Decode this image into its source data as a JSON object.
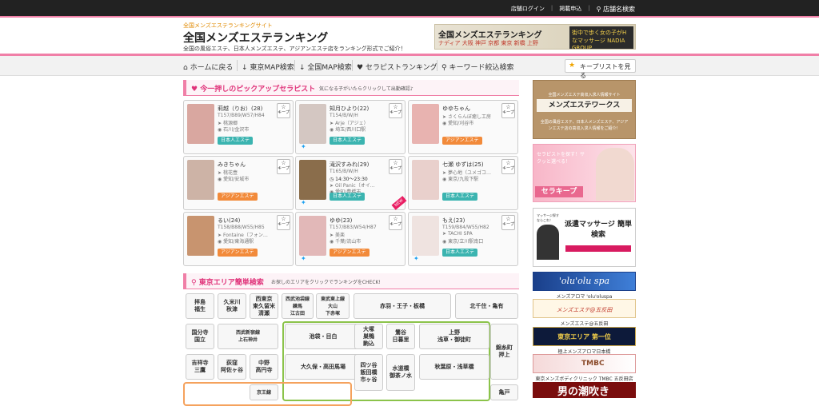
{
  "topbar": {
    "login": "店舗ログイン",
    "listing": "掲載申込",
    "search": "店舗名検索"
  },
  "header": {
    "sub": "全国メンズエステランキングサイト",
    "title": "全国メンズエステランキング",
    "desc": "全国の風俗エステ、日本人メンズエステ、アジアンエステ店をランキング形式でご紹介！",
    "banner": {
      "line1": "全国メンズエステランキング",
      "line2": "ナディア 大阪 神戸 京都 東京 新橋 上野",
      "line3": "街中で歩く女の子がHなマッサージ NADIA GROUP"
    }
  },
  "nav": {
    "items": [
      "ホームに戻る",
      "東京MAP検索",
      "全国MAP検索",
      "セラピストランキング",
      "キーワード絞込検索"
    ],
    "keeplist": "キープリストを見る"
  },
  "pickup": {
    "title": "今一押しのピックアップセラピスト",
    "subtitle": "気になる子がいたらクリックして出勤確認♪",
    "keep_label": "キープ",
    "cards": [
      {
        "name": "莉越（りお）(28)",
        "size": "T157/B89/W57/H84",
        "shop": "桃源郷",
        "area": "石川/金沢市",
        "tag": "日本人エステ",
        "tagtype": "jp",
        "color": "#d9a7a0"
      },
      {
        "name": "知月ひより(22)",
        "size": "T154/B/W/H",
        "shop": "Arje（アジェ）",
        "area": "埼玉/西川口駅",
        "tag": "日本人エステ",
        "tagtype": "jp",
        "color": "#d4c7c2"
      },
      {
        "name": "ゆゆちゃん",
        "size": "",
        "shop": "さくらんぼ癒し工房",
        "area": "愛知/刈谷市",
        "tag": "アジアンエステ",
        "tagtype": "asia",
        "color": "#e8b3b0"
      },
      {
        "name": "みきちゃん",
        "size": "",
        "shop": "桃花壺",
        "area": "愛知/安城市",
        "tag": "アジアンエステ",
        "tagtype": "asia",
        "color": "#cdb3a6"
      },
      {
        "name": "滝沢すみれ(29)",
        "size": "T165/B/W/H",
        "shop": "Oil Panic（オイ…",
        "area": "愛知/豊橋市",
        "tag": "日本人エステ",
        "tagtype": "jp",
        "time": "14:30〜23:30",
        "color": "#8a6d4b"
      },
      {
        "name": "七瀬 ゆずは(25)",
        "size": "",
        "shop": "夢心地（ユメゴコ…",
        "area": "東京/九段下駅",
        "tag": "日本人エステ",
        "tagtype": "jp",
        "color": "#e9d0cc"
      },
      {
        "name": "るい(24)",
        "size": "T158/B88/W55/H85",
        "shop": "Fontaine（フォン…",
        "area": "愛知/東海通駅",
        "tag": "アジアンエステ",
        "tagtype": "asia",
        "color": "#c8946f"
      },
      {
        "name": "ゆゆ(23)",
        "size": "T157/B83/W54/H87",
        "shop": "美楽",
        "area": "千葉/流山市",
        "tag": "アジアンエステ",
        "tagtype": "asia",
        "color": "#e2b8b8"
      },
      {
        "name": "もえ(23)",
        "size": "T159/B84/W55/H82",
        "shop": "TACHI SPA",
        "area": "東京/立川駅南口",
        "tag": "日本人エステ",
        "tagtype": "jp",
        "color": "#efe3e0"
      }
    ]
  },
  "tokyo": {
    "title": "東京エリア簡単検索",
    "subtitle": "お探しのエリアをクリックでランキングをCHECK!",
    "areas": [
      "拝島\n福生",
      "久米川\n秋津",
      "西東京\n東久留米\n清瀬",
      "西武池袋線\n練馬\n江古田",
      "東武東上線\n大山\n下赤塚",
      "赤羽・王子・板橋",
      "北千住・亀有",
      "国分寺\n国立",
      "西武新宿線\n上石神井",
      "池袋・目白",
      "大塚\n巣鴨\n駒込",
      "鶯谷\n日暮里",
      "上野\n浅草・御徒町",
      "錦糸町\n押上",
      "吉祥寺\n三鷹",
      "荻窪\n阿佐ヶ谷",
      "中野\n高円寺",
      "大久保・高田馬場",
      "四ツ谷\n飯田橋\n市ヶ谷",
      "水道橋\n御茶ノ水",
      "秋葉原・浅草橋",
      "京王線",
      "亀戸"
    ]
  },
  "sidebar": {
    "works": {
      "sub": "全国メンズエステ高収入求人情報サイト",
      "title": "メンズエステワークス",
      "desc": "全国の風俗エステ、日本人メンズエステ、アジアンエステ店の高収入求人情報をご紹介！"
    },
    "serakeep": {
      "title": "セラキープ",
      "desc": "セラピストを探す！サクッと選べる！"
    },
    "haken": {
      "title": "派遣マッサージ 簡単検索",
      "sub": "マッサージ探すならこれ！"
    },
    "olu": {
      "title": "'olu'olu spa",
      "caption": "メンズアロマ 'olu'oluspa"
    },
    "gotanda": {
      "title": "メンズエステ@五反田",
      "caption": "メンズエステ@五反田"
    },
    "eria": {
      "title": "東京エリア 第一位",
      "caption": "極上メンズアロマ日本橋"
    },
    "tmbc": {
      "title": "TMBC",
      "caption": "東京メンズボディクリニック TMBC 五反田店"
    },
    "last": {
      "title": "男の潮吹き"
    }
  }
}
